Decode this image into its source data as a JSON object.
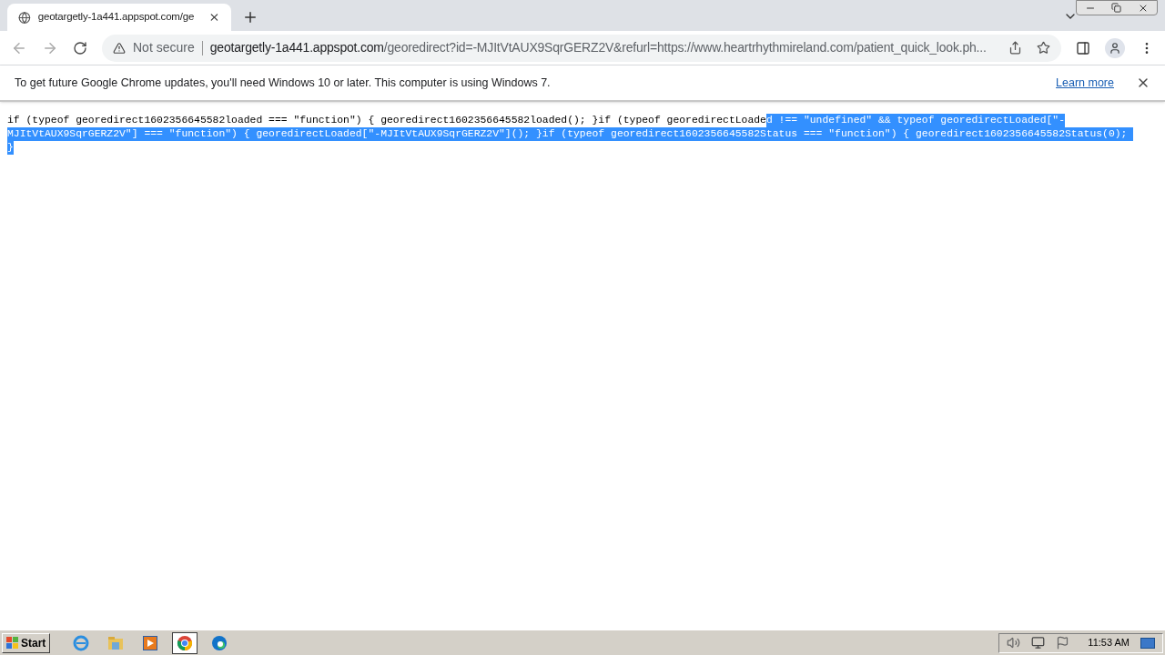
{
  "tabs": [
    {
      "title": "geotargetly-1a441.appspot.com/ge",
      "selected": true
    }
  ],
  "address_bar": {
    "security": "Not secure",
    "host": "geotargetly-1a441.appspot.com",
    "path": "/georedirect?id=-MJItVtAUX9SqrGERZ2V&refurl=https://www.heartrhythmireland.com/patient_quick_look.ph..."
  },
  "infobar": {
    "message": "To get future Google Chrome updates, you'll need Windows 10 or later. This computer is using Windows 7.",
    "link": "Learn more"
  },
  "code_lines": [
    [
      {
        "text": "if (typeof georedirect1602356645582loaded === \"function\") { georedirect1602356645582loaded(); }if (typeof georedirectLoade",
        "selected": false
      },
      {
        "text": "d !== \"undefined\" && typeof georedirectLoaded[\"-",
        "selected": true
      }
    ],
    [
      {
        "text": "MJItVtAUX9SqrGERZ2V\"] === \"function\") { georedirectLoaded[\"-MJItVtAUX9SqrGERZ2V\"](); }if (typeof georedirect1602356645582Status === \"function\") { georedirect1602356645582Status(0); ",
        "selected": true
      }
    ],
    [
      {
        "text": "}",
        "selected": true
      }
    ]
  ],
  "taskbar": {
    "start": "Start",
    "apps": [
      {
        "kind": "ie",
        "selected": false
      },
      {
        "kind": "folder",
        "selected": false
      },
      {
        "kind": "media",
        "selected": false
      },
      {
        "kind": "chrome",
        "selected": true
      },
      {
        "kind": "edge",
        "selected": false
      }
    ],
    "clock": "11:53 AM"
  }
}
